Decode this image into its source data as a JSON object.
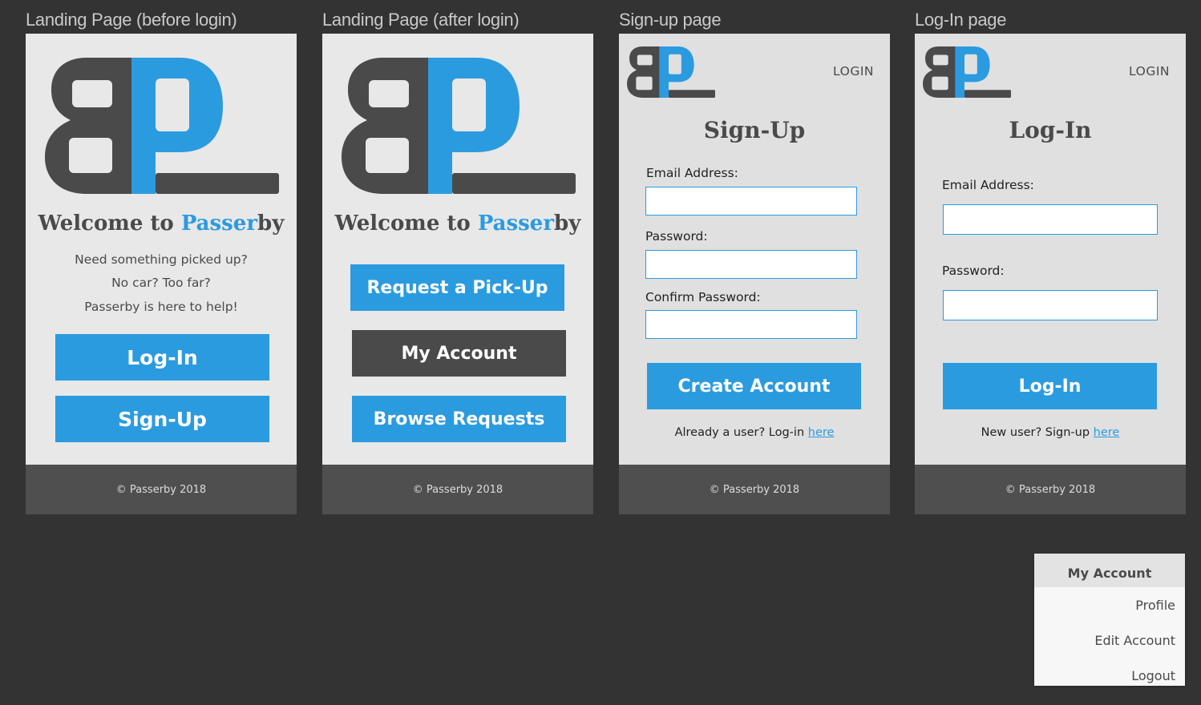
{
  "screens": {
    "landing_before": {
      "title": "Landing Page (before login)",
      "welcome_prefix": "Welcome to ",
      "welcome_accent": "Passer",
      "welcome_suffix": "by",
      "tagline": [
        "Need something picked up?",
        "No car? Too far?",
        "Passerby is here to help!"
      ],
      "login_button": "Log-In",
      "signup_button": "Sign-Up",
      "footer": "© Passerby 2018"
    },
    "landing_after": {
      "title": "Landing Page (after login)",
      "welcome_prefix": "Welcome to ",
      "welcome_accent": "Passer",
      "welcome_suffix": "by",
      "request_button": "Request a Pick-Up",
      "account_button": "My Account",
      "browse_button": "Browse Requests",
      "footer": "© Passerby 2018"
    },
    "signup": {
      "title": "Sign-up page",
      "nav_link": "LOGIN",
      "heading": "Sign-Up",
      "email_label": "Email Address:",
      "email_value": "",
      "password_label": "Password:",
      "password_value": "",
      "confirm_label": "Confirm Password:",
      "confirm_value": "",
      "submit_button": "Create Account",
      "hint_text": "Already a user? Log-in ",
      "hint_link": "here",
      "footer": "© Passerby 2018"
    },
    "login": {
      "title": "Log-In page",
      "nav_link": "LOGIN",
      "heading": "Log-In",
      "email_label": "Email Address:",
      "email_value": "",
      "password_label": "Password:",
      "password_value": "",
      "submit_button": "Log-In",
      "hint_text": "New user? Sign-up ",
      "hint_link": "here",
      "footer": "© Passerby 2018"
    }
  },
  "account_menu": {
    "header": "My Account",
    "items": [
      "Profile",
      "Edit Account",
      "Logout"
    ]
  },
  "colors": {
    "background": "#333333",
    "accent": "#2b9be0",
    "dark": "#4a4a4a",
    "panel": "#e8e8e8",
    "footer": "#4f4f4f"
  },
  "icons": [
    "bp-logo-icon"
  ]
}
